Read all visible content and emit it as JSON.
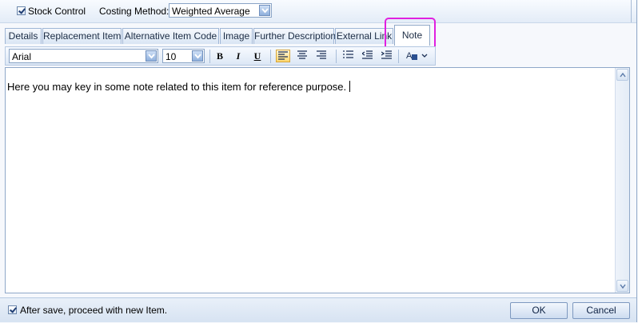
{
  "top": {
    "stock_control_label": "Stock Control",
    "stock_control_checked": true,
    "costing_method_label": "Costing Method:",
    "costing_method_value": "Weighted Average"
  },
  "tabs": [
    {
      "label": "Details"
    },
    {
      "label": "Replacement Item"
    },
    {
      "label": "Alternative Item Code"
    },
    {
      "label": "Image"
    },
    {
      "label": "Further Description"
    },
    {
      "label": "External Link"
    },
    {
      "label": "Note",
      "active": true
    }
  ],
  "toolbar": {
    "font_name": "Arial",
    "font_size": "10",
    "bold_label": "B",
    "italic_label": "I",
    "underline_label": "U"
  },
  "editor": {
    "text": "Here you may key in some note related to this item for reference purpose."
  },
  "footer": {
    "after_save_label": "After save, proceed with new Item.",
    "after_save_checked": true,
    "ok_label": "OK",
    "cancel_label": "Cancel"
  },
  "colors": {
    "highlight": "#e020e0",
    "selected_tool": "#ffd86e"
  }
}
